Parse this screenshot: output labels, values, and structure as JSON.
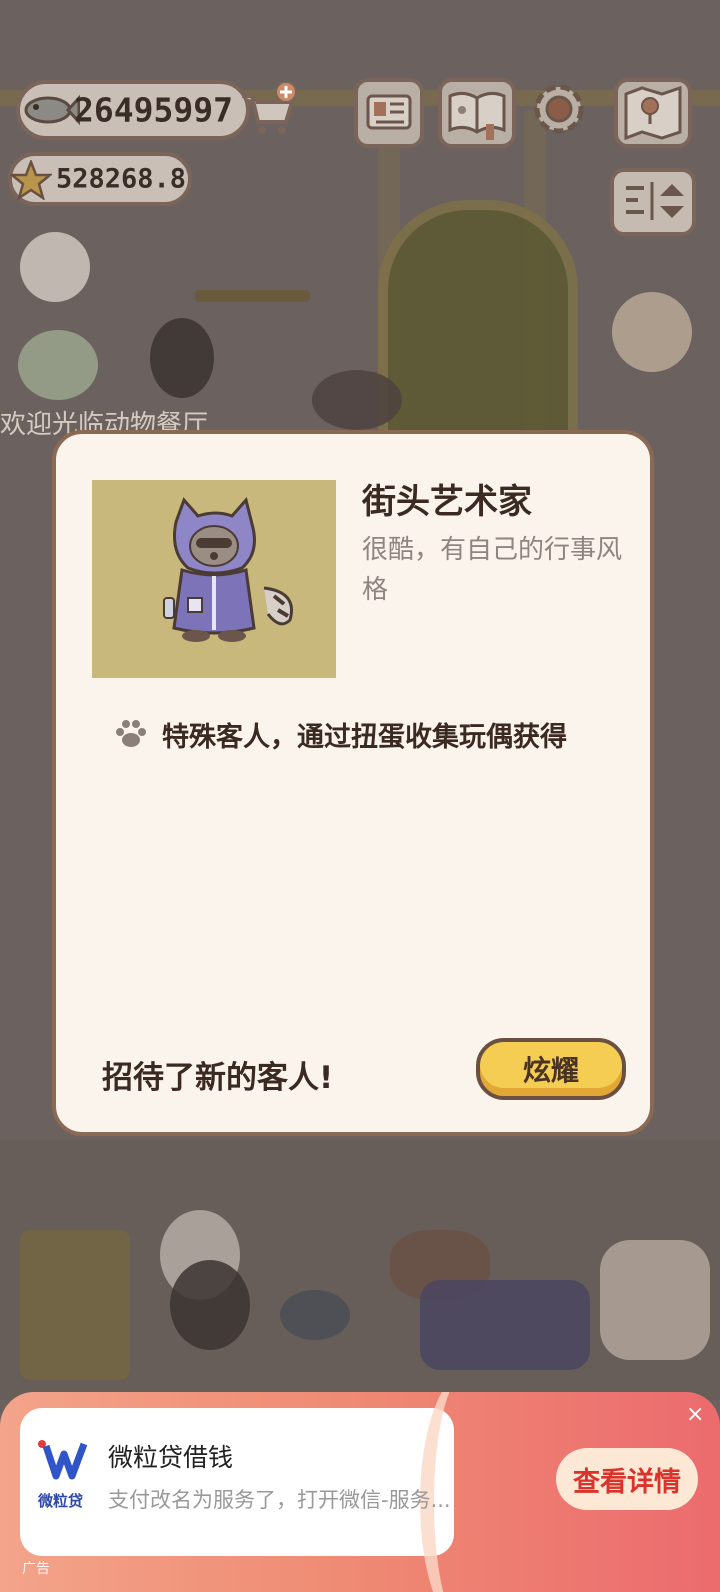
{
  "hud": {
    "fish_currency": "26495997",
    "star_currency": "528268.8"
  },
  "background": {
    "welcome_text": "欢迎光临动物餐厅"
  },
  "modal": {
    "name": "街头艺术家",
    "description": "很酷，有自己的行事风格",
    "how_to_get": "特殊客人，通过扭蛋收集玩偶获得",
    "footer_message": "招待了新的客人!",
    "show_off_button": "炫耀"
  },
  "ad": {
    "logo_label": "微粒贷",
    "title": "微粒贷借钱",
    "description": "支付改名为服务了，打开微信-服务...",
    "cta": "查看详情",
    "close": "×",
    "tag": "广告"
  },
  "colors": {
    "modal_bg": "#fbf4ec",
    "show_button": "#f5cd53",
    "ad_cta_text": "#d9332c"
  }
}
